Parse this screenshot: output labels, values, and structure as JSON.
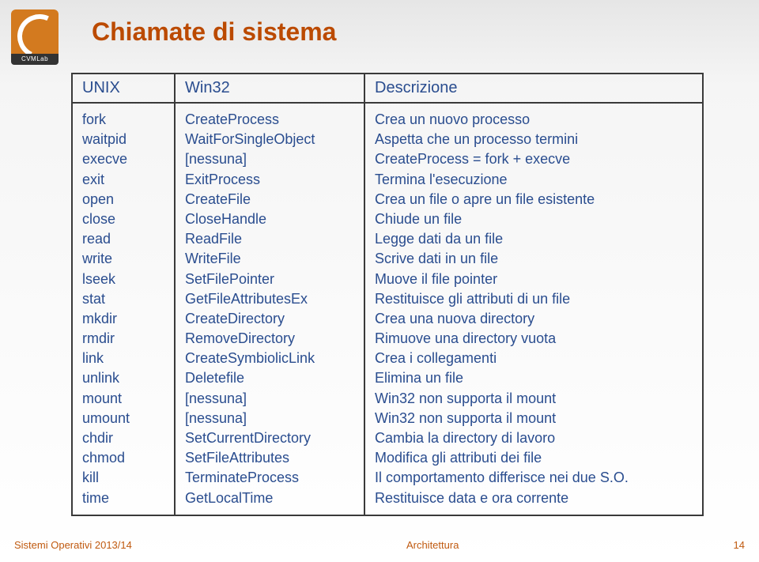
{
  "logo_text": "CVMLab",
  "title": "Chiamate di sistema",
  "headers": {
    "c1": "UNIX",
    "c2": "Win32",
    "c3": "Descrizione"
  },
  "rows": [
    {
      "unix": "fork",
      "win32": "CreateProcess",
      "desc": "Crea un nuovo processo"
    },
    {
      "unix": "waitpid",
      "win32": "WaitForSingleObject",
      "desc": "Aspetta che un processo termini"
    },
    {
      "unix": "execve",
      "win32": "[nessuna]",
      "desc": "CreateProcess = fork + execve"
    },
    {
      "unix": "exit",
      "win32": "ExitProcess",
      "desc": "Termina l'esecuzione"
    },
    {
      "unix": "open",
      "win32": "CreateFile",
      "desc": "Crea un file o apre un file esistente"
    },
    {
      "unix": "close",
      "win32": "CloseHandle",
      "desc": "Chiude un file"
    },
    {
      "unix": "read",
      "win32": "ReadFile",
      "desc": "Legge dati da un file"
    },
    {
      "unix": "write",
      "win32": "WriteFile",
      "desc": "Scrive dati in un file"
    },
    {
      "unix": "lseek",
      "win32": "SetFilePointer",
      "desc": "Muove il file pointer"
    },
    {
      "unix": "stat",
      "win32": "GetFileAttributesEx",
      "desc": "Restituisce gli attributi di un file"
    },
    {
      "unix": "mkdir",
      "win32": "CreateDirectory",
      "desc": "Crea una nuova directory"
    },
    {
      "unix": "rmdir",
      "win32": "RemoveDirectory",
      "desc": "Rimuove una directory vuota"
    },
    {
      "unix": "link",
      "win32": "CreateSymbiolicLink",
      "desc": "Crea i collegamenti"
    },
    {
      "unix": "unlink",
      "win32": "Deletefile",
      "desc": "Elimina un file"
    },
    {
      "unix": "mount",
      "win32": "[nessuna]",
      "desc": "Win32 non supporta il mount"
    },
    {
      "unix": "umount",
      "win32": "[nessuna]",
      "desc": "Win32 non supporta il mount"
    },
    {
      "unix": "chdir",
      "win32": "SetCurrentDirectory",
      "desc": "Cambia la directory di lavoro"
    },
    {
      "unix": "chmod",
      "win32": "SetFileAttributes",
      "desc": "Modifica gli attributi dei file"
    },
    {
      "unix": "kill",
      "win32": "TerminateProcess",
      "desc": "Il comportamento differisce nei due S.O."
    },
    {
      "unix": "time",
      "win32": "GetLocalTime",
      "desc": "Restituisce data e ora corrente"
    }
  ],
  "footer": {
    "left": "Sistemi Operativi 2013/14",
    "mid": "Architettura",
    "right": "14"
  }
}
